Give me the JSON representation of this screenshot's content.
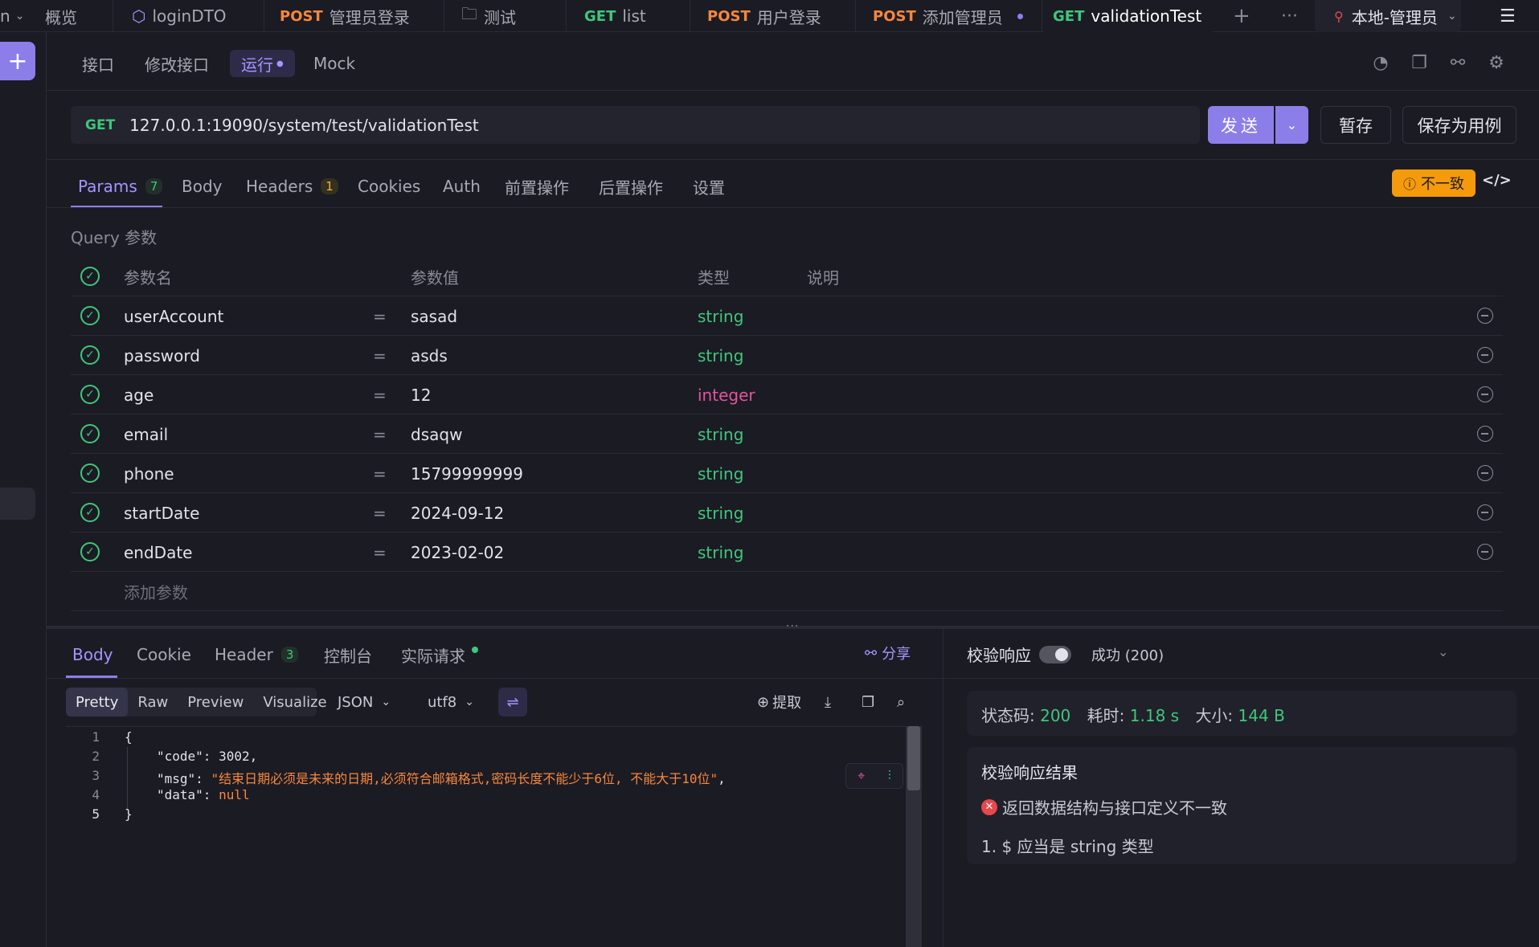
{
  "tabs": [
    {
      "method": "",
      "label": "n",
      "left": 0
    },
    {
      "method": "",
      "label": "概览"
    },
    {
      "method": "",
      "label": "loginDTO"
    },
    {
      "method": "POST",
      "label": "管理员登录"
    },
    {
      "method": "",
      "label": "测试"
    },
    {
      "method": "GET",
      "label": "list"
    },
    {
      "method": "POST",
      "label": "用户登录"
    },
    {
      "method": "POST",
      "label": "添加管理员"
    },
    {
      "method": "GET",
      "label": "validationTest"
    }
  ],
  "environment": "本地-管理员",
  "subtabs": {
    "t1": "接口",
    "t2": "修改接口",
    "t3": "运行",
    "t4": "Mock"
  },
  "request": {
    "method": "GET",
    "url": "127.0.0.1:19090/system/test/validationTest",
    "send": "发送",
    "save_temp": "暂存",
    "save_case": "保存为用例"
  },
  "req_tabs": {
    "params": "Params",
    "params_count": "7",
    "body": "Body",
    "headers": "Headers",
    "headers_count": "1",
    "cookies": "Cookies",
    "auth": "Auth",
    "pre": "前置操作",
    "post": "后置操作",
    "settings": "设置"
  },
  "inconsistent": "不一致",
  "query_title": "Query 参数",
  "param_headers": {
    "name": "参数名",
    "value": "参数值",
    "type": "类型",
    "desc": "说明"
  },
  "params": [
    {
      "name": "userAccount",
      "value": "sasad",
      "type": "string"
    },
    {
      "name": "password",
      "value": "asds",
      "type": "string"
    },
    {
      "name": "age",
      "value": "12",
      "type": "integer"
    },
    {
      "name": "email",
      "value": "dsaqw",
      "type": "string"
    },
    {
      "name": "phone",
      "value": "15799999999",
      "type": "string"
    },
    {
      "name": "startDate",
      "value": "2024-09-12",
      "type": "string"
    },
    {
      "name": "endDate",
      "value": "2023-02-02",
      "type": "string"
    }
  ],
  "add_param": "添加参数",
  "resp_tabs": {
    "body": "Body",
    "cookie": "Cookie",
    "header": "Header",
    "header_count": "3",
    "console": "控制台",
    "actual": "实际请求"
  },
  "share": "分享",
  "view_modes": {
    "pretty": "Pretty",
    "raw": "Raw",
    "preview": "Preview",
    "visualize": "Visualize"
  },
  "format": "JSON",
  "encoding": "utf8",
  "extract": "提取",
  "code": {
    "l1": "{",
    "code_key": "\"code\"",
    "code_val": "3002",
    "msg_key": "\"msg\"",
    "msg_val": "\"结束日期必须是未来的日期,必须符合邮箱格式,密码长度不能少于6位, 不能大于10位\"",
    "data_key": "\"data\"",
    "data_val": "null",
    "l5": "}"
  },
  "validate": {
    "title": "校验响应",
    "status_label": "成功 (200)",
    "status_code_label": "状态码:",
    "status_code": "200",
    "time_label": "耗时:",
    "time": "1.18 s",
    "size_label": "大小:",
    "size": "144 B",
    "result_title": "校验响应结果",
    "error": "返回数据结构与接口定义不一致",
    "detail": "1. $ 应当是 string 类型"
  }
}
